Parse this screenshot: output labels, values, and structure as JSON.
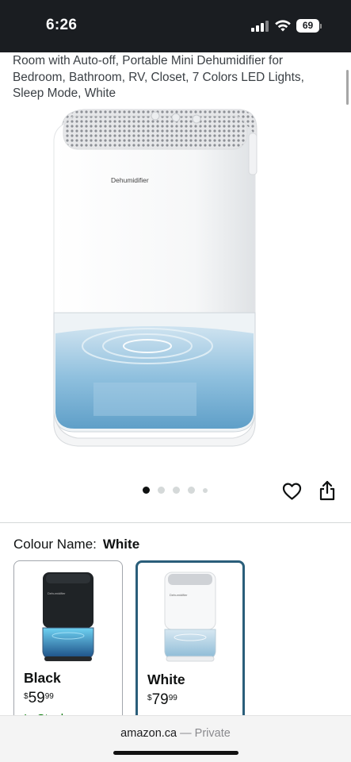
{
  "status_bar": {
    "time": "6:26",
    "battery": "69",
    "icons": [
      "signal-icon",
      "wifi-icon",
      "battery-icon"
    ]
  },
  "product": {
    "title": "Room with Auto-off, Portable Mini Dehumidifier for Bedroom, Bathroom, RV, Closet, 7 Colors LED Lights, Sleep Mode, White",
    "device_label": "Dehumidifier",
    "image_count": 5,
    "active_image": 1,
    "icons": [
      "heart-icon",
      "share-icon"
    ]
  },
  "colour": {
    "label": "Colour Name:",
    "value": "White",
    "options": [
      {
        "name": "Black",
        "currency": "$",
        "price_whole": "59",
        "price_cents": "99",
        "stock": "In Stock",
        "selected": false
      },
      {
        "name": "White",
        "currency": "$",
        "price_whole": "79",
        "price_cents": "99",
        "stock": "",
        "selected": true
      }
    ]
  },
  "browser": {
    "domain": "amazon.ca",
    "separator": "—",
    "mode": "Private"
  },
  "colors": {
    "status_bar_bg": "#1a1d21",
    "selected_border": "#2a5e7a",
    "in_stock": "#007600",
    "water_blue": "#7fb6d8"
  }
}
